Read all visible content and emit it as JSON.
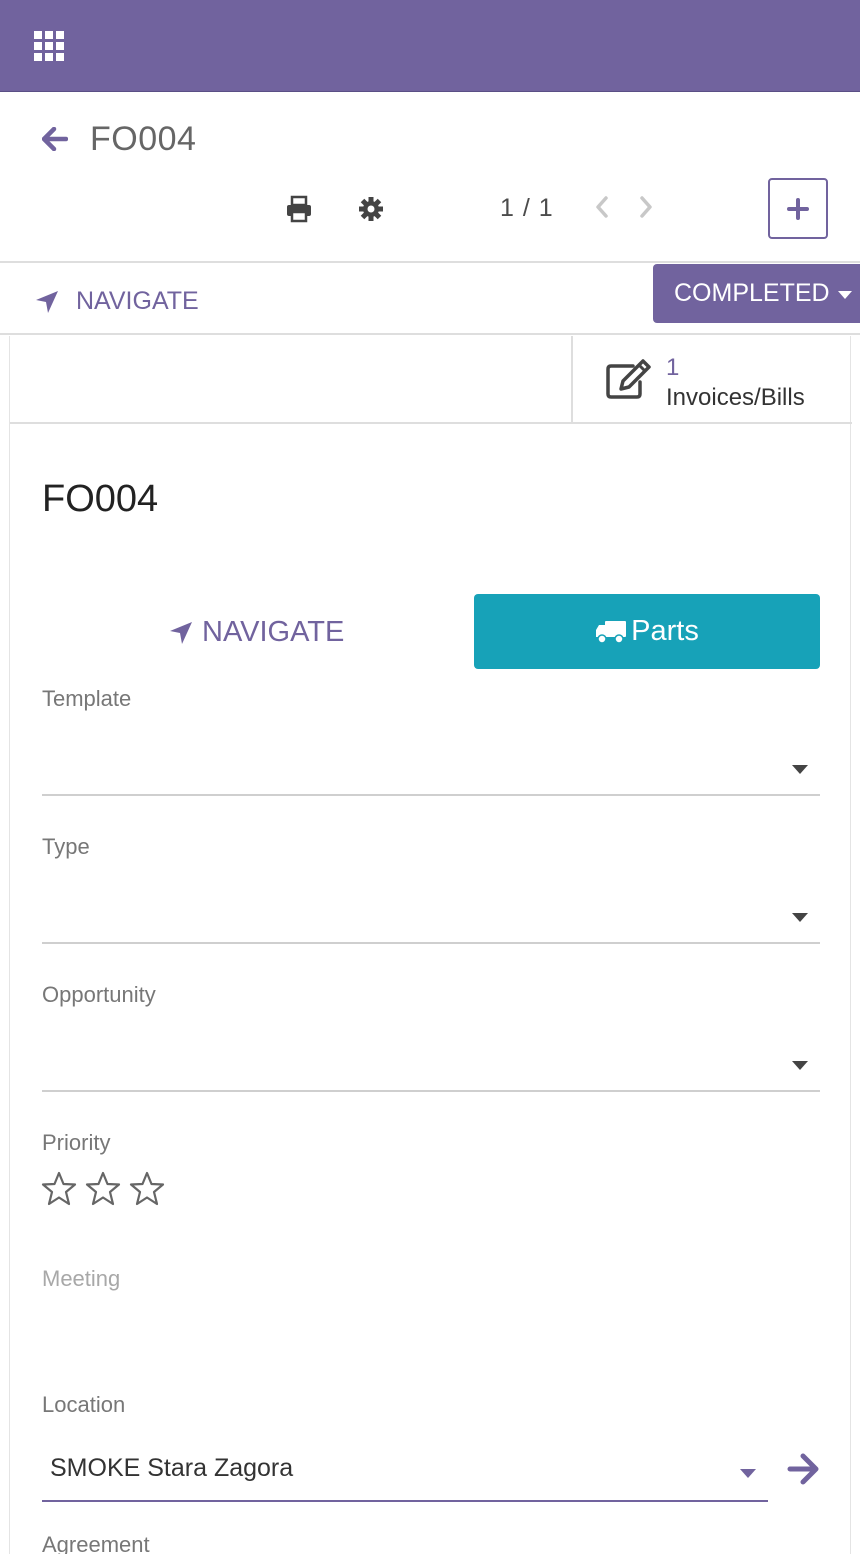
{
  "topbar": {
    "apps_icon": "apps-grid-icon",
    "color": "#71639e"
  },
  "breadcrumb": {
    "back_icon": "arrow-left-icon",
    "title": "FO004"
  },
  "controls": {
    "print_icon": "print-icon",
    "action_icon": "gear-icon",
    "pager": "1 / 1",
    "prev_icon": "chevron-left-icon",
    "next_icon": "chevron-right-icon",
    "create_icon": "plus-icon"
  },
  "statusbar": {
    "navigate_label": "NAVIGATE",
    "status_label": "COMPLETED"
  },
  "smart_button": {
    "count": "1",
    "label": "Invoices/Bills",
    "icon": "edit-icon"
  },
  "record": {
    "name": "FO004"
  },
  "actions": {
    "navigate_label": "NAVIGATE",
    "parts_label": "Parts",
    "parts_icon": "truck-icon",
    "accent": "#17a2b8"
  },
  "fields": {
    "template": {
      "label": "Template",
      "value": ""
    },
    "type": {
      "label": "Type",
      "value": ""
    },
    "opportunity": {
      "label": "Opportunity",
      "value": ""
    },
    "priority": {
      "label": "Priority",
      "stars_total": 3,
      "stars_filled": 0
    },
    "meeting": {
      "label": "Meeting"
    },
    "location": {
      "label": "Location",
      "value": "SMOKE Stara Zagora"
    },
    "agreement": {
      "label": "Agreement"
    }
  }
}
